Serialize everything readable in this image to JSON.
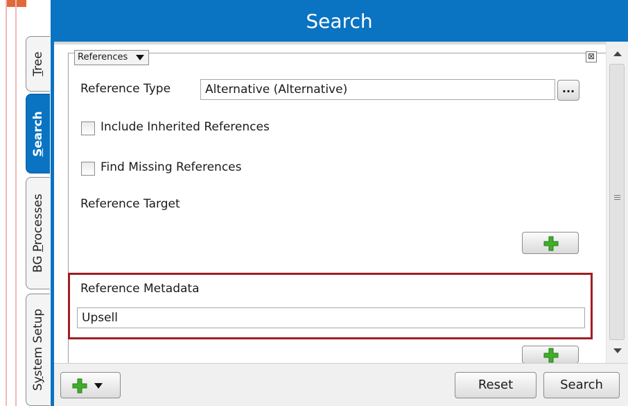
{
  "sidebar": {
    "tabs": [
      {
        "label": "Tree",
        "underline": "T",
        "rest": "ree",
        "active": false
      },
      {
        "label": "Search",
        "underline": "S",
        "rest": "earch",
        "active": true
      },
      {
        "label": "BG Processes",
        "before": "BG ",
        "underline": "P",
        "rest": "rocesses",
        "active": false
      },
      {
        "label": "System Setup",
        "before": "S",
        "underline": "y",
        "rest": "stem Setup",
        "active": false
      }
    ]
  },
  "header": {
    "title": "Search"
  },
  "criteria": {
    "dropdown_label": "References",
    "close_label": "⊠",
    "reference_type": {
      "label": "Reference Type",
      "value": "Alternative (Alternative)",
      "browse_label": "..."
    },
    "include_inherited": {
      "label": "Include Inherited References",
      "checked": false
    },
    "find_missing": {
      "label": "Find Missing References",
      "checked": false
    },
    "reference_target": {
      "label": "Reference Target"
    },
    "reference_metadata": {
      "label": "Reference Metadata",
      "value": "Upsell"
    }
  },
  "footer": {
    "reset_label": "Reset",
    "search_label": "Search"
  },
  "colors": {
    "brand_blue": "#0a73c2",
    "highlight_red": "#9e1e24",
    "plus_green": "#3fae29"
  },
  "icons": {
    "add": "plus-icon",
    "menu": "chevron-down-icon",
    "close": "close-icon"
  }
}
